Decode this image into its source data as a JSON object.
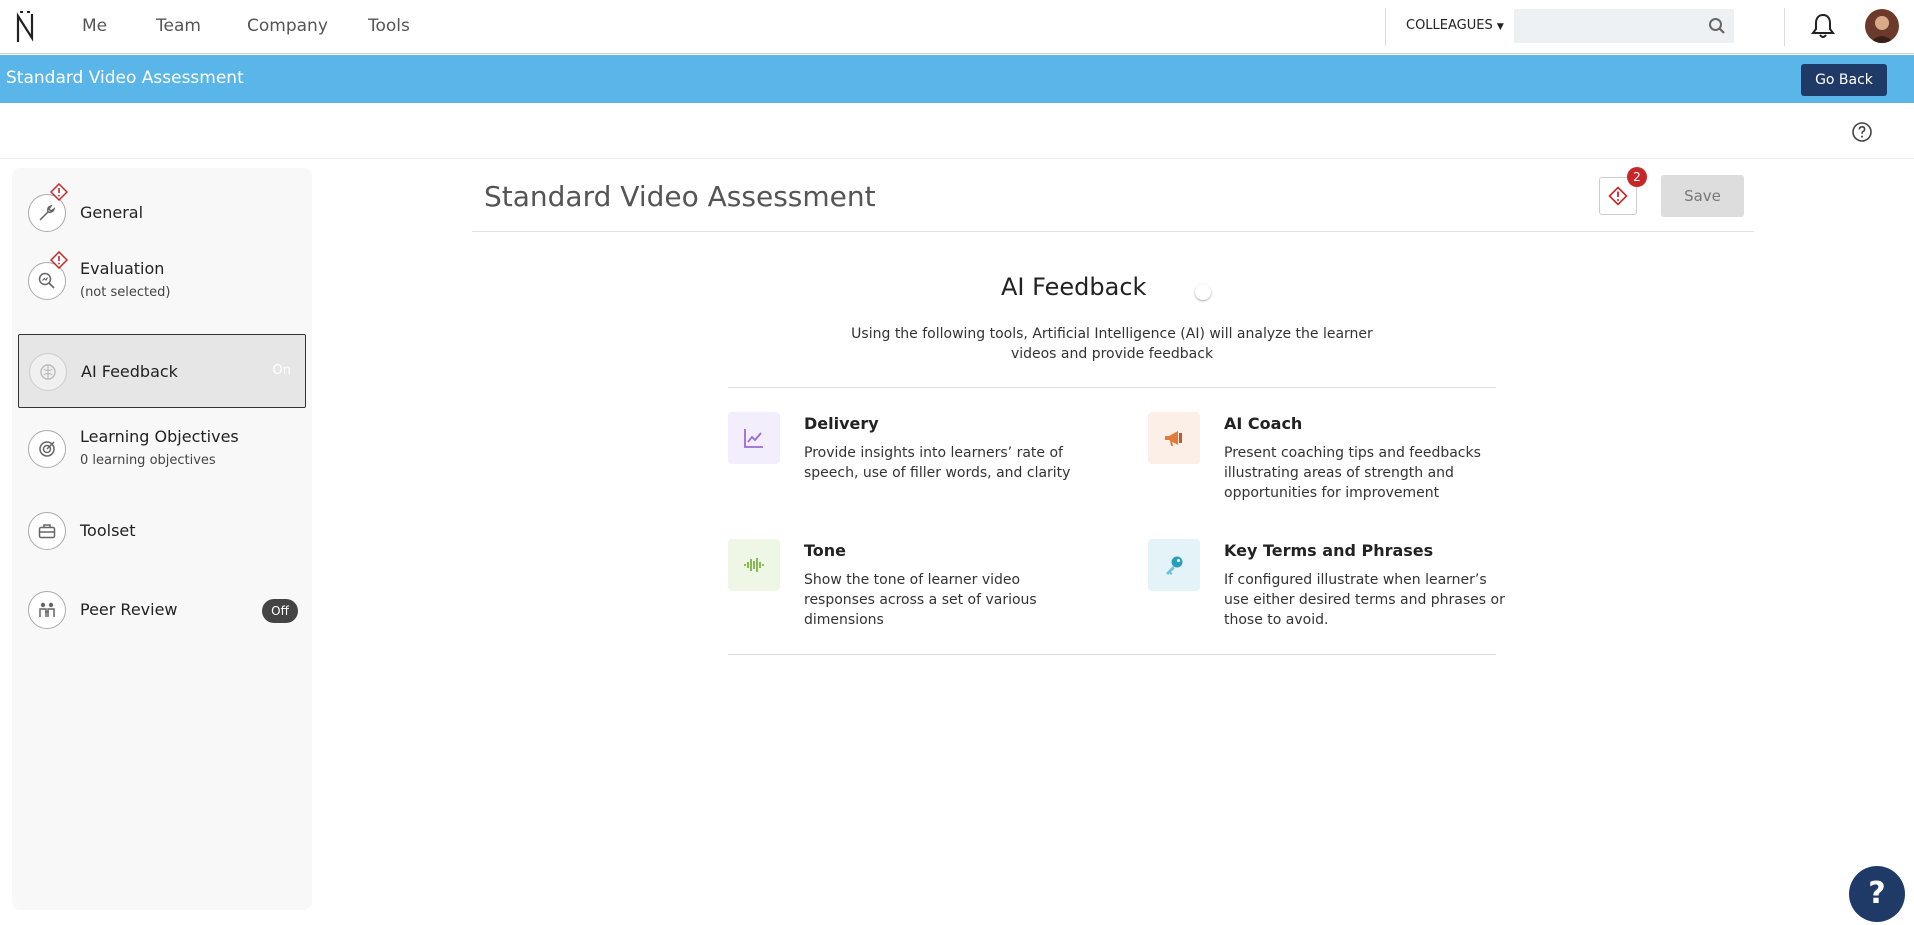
{
  "nav": {
    "links": [
      "Me",
      "Team",
      "Company",
      "Tools"
    ],
    "colleagues_label": "COLLEAGUES",
    "search_placeholder": ""
  },
  "banner": {
    "title": "Standard Video Assessment",
    "go_back_label": "Go Back"
  },
  "sidebar": {
    "items": [
      {
        "label": "General",
        "sub": "",
        "status": "",
        "warning": true,
        "icon": "wrench-icon"
      },
      {
        "label": "Evaluation",
        "sub": "(not selected)",
        "status": "",
        "warning": true,
        "icon": "magnify-chart-icon"
      },
      {
        "label": "AI Feedback",
        "sub": "",
        "status": "On",
        "warning": false,
        "icon": "brain-icon"
      },
      {
        "label": "Learning Objectives",
        "sub": "0 learning objectives",
        "status": "",
        "warning": false,
        "icon": "target-icon"
      },
      {
        "label": "Toolset",
        "sub": "",
        "status": "",
        "warning": false,
        "icon": "toolbox-icon"
      },
      {
        "label": "Peer Review",
        "sub": "",
        "status": "Off",
        "warning": false,
        "icon": "people-icon"
      }
    ]
  },
  "main": {
    "title": "Standard Video Assessment",
    "warning_count": "2",
    "save_label": "Save",
    "ai_title": "AI Feedback",
    "ai_description": "Using the following tools, Artificial Intelligence (AI) will analyze the learner videos and provide feedback",
    "tools": [
      {
        "name": "Delivery",
        "desc": "Provide insights into learners’ rate of speech, use of filler words, and clarity",
        "icon": "line-chart-icon",
        "color": "#9b6bd6",
        "bg": "#f3eefb"
      },
      {
        "name": "AI Coach",
        "desc": "Present coaching tips and feedbacks illustrating areas of strength and opportunities for improvement",
        "icon": "megaphone-icon",
        "color": "#e07b3c",
        "bg": "#fbefe7"
      },
      {
        "name": "Tone",
        "desc": "Show the tone of learner video responses across a set of various dimensions",
        "icon": "sound-wave-icon",
        "color": "#7cb342",
        "bg": "#eef6e6"
      },
      {
        "name": "Key Terms and Phrases",
        "desc": "If configured illustrate when learner’s use either desired terms and phrases or those to avoid.",
        "icon": "key-icon",
        "color": "#2a9dbb",
        "bg": "#e4f3f7"
      }
    ]
  },
  "help_fab_label": "?"
}
